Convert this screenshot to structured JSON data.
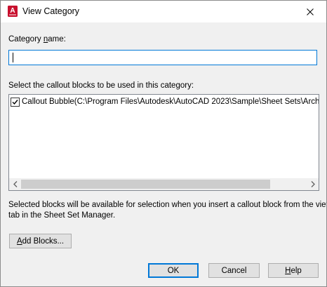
{
  "dialog": {
    "title": "View Category",
    "app_icon_letter": "A",
    "close_glyph": "✕"
  },
  "category_name": {
    "label_prefix": "Category ",
    "label_mnemonic": "n",
    "label_suffix": "ame:",
    "value": ""
  },
  "callout_blocks": {
    "label": "Select the callout blocks to be used in this category:",
    "items": [
      {
        "checked": true,
        "text": "Callout Bubble(C:\\Program Files\\Autodesk\\AutoCAD 2023\\Sample\\Sheet Sets\\Architectural\\"
      }
    ],
    "scroll_left_glyph": "‹",
    "scroll_right_glyph": "›"
  },
  "info_text": {
    "line1": "Selected blocks will be available for selection when you insert a callout block from the view",
    "line2": "tab in the Sheet Set Manager."
  },
  "buttons": {
    "add_blocks": {
      "mnemonic": "A",
      "rest": "dd Blocks..."
    },
    "ok": "OK",
    "cancel": "Cancel",
    "help": {
      "mnemonic": "H",
      "rest": "elp"
    }
  },
  "colors": {
    "accent": "#0078d7",
    "app_icon_red": "#c8102e",
    "window_bg": "#f0f0f0"
  }
}
